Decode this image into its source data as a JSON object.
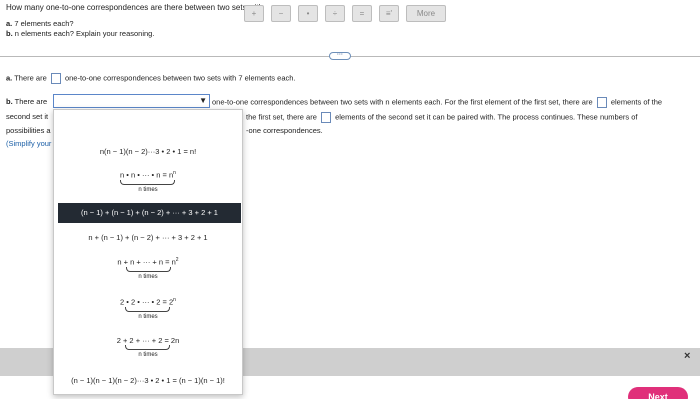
{
  "question": {
    "title": "How many one-to-one correspondences are there between two sets with",
    "part_a_label": "a.",
    "part_a_text": "7 elements each?",
    "part_b_label": "b.",
    "part_b_text": "n elements each? Explain your reasoning."
  },
  "answer_a": {
    "label": "a.",
    "prefix": "There are",
    "suffix": "one-to-one correspondences between two sets with 7 elements each."
  },
  "answer_b": {
    "label": "b.",
    "prefix": "There are",
    "after_select": "one-to-one correspondences between two sets with n elements each. For the first element of the first set, there are",
    "after_box1": "elements of the",
    "line2_left": "second set it",
    "line2_mid": "the first set, there are",
    "line2_right": "elements of the second set it can be paired with. The process continues. These numbers of",
    "line3_left": "possibilities a",
    "line3_right": "-one correspondences.",
    "simplify": "(Simplify your"
  },
  "dropdown": {
    "options": [
      {
        "main": "n(n − 1)(n − 2)···3 • 2 • 1 = n!",
        "under": ""
      },
      {
        "main": "n • n • ··· • n = n",
        "sup": "n",
        "under": "n times"
      },
      {
        "main": "(n − 1) + (n − 1) + (n − 2) + ··· + 3 + 2 + 1",
        "under": ""
      },
      {
        "main": "n + (n − 1) + (n − 2) + ··· + 3 + 2 + 1",
        "under": ""
      },
      {
        "main": "n + n + ··· + n = n",
        "sup": "2",
        "under": "n times"
      },
      {
        "main": "2 • 2 • ··· • 2 = 2",
        "sup": "n",
        "under": "n times"
      },
      {
        "main": "2 + 2 + ··· + 2 = 2n",
        "under": "n times"
      },
      {
        "main": "(n − 1)(n − 1)(n − 2)···3 • 2 • 1 = (n − 1)(n − 1)!",
        "under": ""
      }
    ],
    "selected_index": 2
  },
  "toolbar": {
    "buttons": [
      "+",
      "−",
      "•",
      "÷",
      "=",
      "≡'",
      "More"
    ],
    "close": "×",
    "next": "Next"
  }
}
